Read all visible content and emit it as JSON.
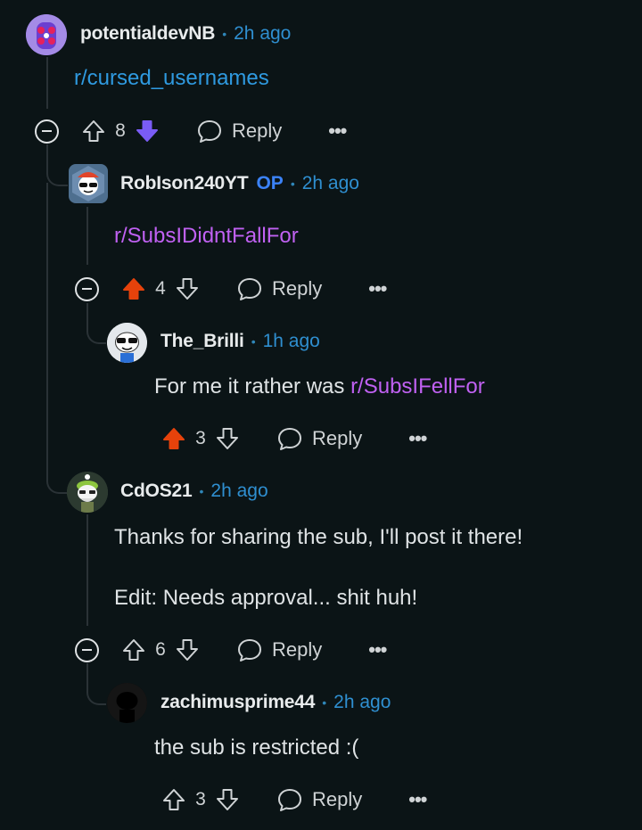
{
  "colors": {
    "background": "#0b1416",
    "time": "#2f8fd0",
    "link_blue": "#2f9ae0",
    "link_purple": "#c061f2",
    "upvote_active": "#e6420b",
    "downvote_active": "#7a5cf5",
    "op_tag": "#3b82f6"
  },
  "comments": [
    {
      "username": "potentialdevNB",
      "time": "2h ago",
      "body_link": "r/cursed_usernames",
      "score": "8",
      "vote": "down",
      "reply_label": "Reply",
      "more_label": "•••"
    },
    {
      "username": "RobIson240YT",
      "op_label": "OP",
      "time": "2h ago",
      "body_link": "r/SubsIDidntFallFor",
      "score": "4",
      "vote": "up",
      "reply_label": "Reply",
      "more_label": "•••"
    },
    {
      "username": "The_Brilli",
      "time": "1h ago",
      "body_prefix": "For me it rather was ",
      "body_link": "r/SubsIFellFor",
      "score": "3",
      "vote": "up",
      "reply_label": "Reply",
      "more_label": "•••"
    },
    {
      "username": "CdOS21",
      "time": "2h ago",
      "body_line1": "Thanks for sharing the sub, I'll post it there!",
      "body_line2": "Edit: Needs approval... shit huh!",
      "score": "6",
      "vote": "none",
      "reply_label": "Reply",
      "more_label": "•••"
    },
    {
      "username": "zachimusprime44",
      "time": "2h ago",
      "body": "the sub is restricted :(",
      "score": "3",
      "vote": "none",
      "reply_label": "Reply",
      "more_label": "•••"
    }
  ],
  "separator": "•",
  "icons": {
    "collapse": "collapse-minus-icon",
    "upvote": "upvote-arrow-icon",
    "downvote": "downvote-arrow-icon",
    "reply": "speech-bubble-icon",
    "more": "ellipsis-icon"
  }
}
